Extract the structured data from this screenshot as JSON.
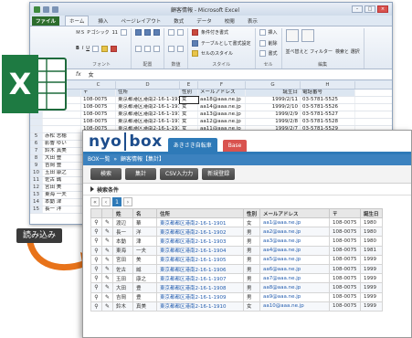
{
  "excel": {
    "title": "顧客情報 - Microsoft Excel",
    "tabs": [
      "ファイル",
      "ホーム",
      "挿入",
      "ページレイアウト",
      "数式",
      "データ",
      "校閲",
      "表示"
    ],
    "font_name": "ＭＳ Ｐゴシック",
    "font_size": "11",
    "ribbon": {
      "conditional_format": "条件付き書式",
      "table_format": "テーブルとして書式設定",
      "cell_style": "セルのスタイル",
      "style_label": "スタイル",
      "insert": "挿入",
      "delete": "削除",
      "format": "書式",
      "cell_label": "セル",
      "sort_filter": "並べ替えと フィルター",
      "find_select": "検索と 選択",
      "edit_label": "編集",
      "clipboard_label": "クリップ",
      "font_label": "フォント",
      "align_label": "配置",
      "number_label": "数値"
    },
    "formula_value": "女",
    "columns": [
      "C",
      "D",
      "E",
      "F",
      "G",
      "H"
    ],
    "header_row": {
      "num": "",
      "name": "",
      "zip": "〒",
      "addr": "住所",
      "sex": "性別",
      "mail": "メールアドレス",
      "birth": "誕生日",
      "tel": "電話番号"
    },
    "rows": [
      {
        "num": "",
        "name": "",
        "zip": "108-0075",
        "addr": "東京都港区港南2-16-1-1915",
        "sex": "女",
        "mail": "aa18@aaa.ne.jp",
        "birth": "1999/2/11",
        "tel": "03-5781-5525"
      },
      {
        "num": "",
        "name": "",
        "zip": "108-0075",
        "addr": "東京都港区港南2-16-1-1914",
        "sex": "女",
        "mail": "aa14@aaa.ne.jp",
        "birth": "1999/2/10",
        "tel": "03-5781-5526"
      },
      {
        "num": "",
        "name": "",
        "zip": "108-0075",
        "addr": "東京都港区港南2-16-1-1913",
        "sex": "女",
        "mail": "aa13@aaa.ne.jp",
        "birth": "1999/2/9",
        "tel": "03-5781-5527"
      },
      {
        "num": "",
        "name": "",
        "zip": "108-0075",
        "addr": "東京都港区港南2-16-1-1912",
        "sex": "女",
        "mail": "aa12@aaa.ne.jp",
        "birth": "1999/2/8",
        "tel": "03-5781-5528"
      },
      {
        "num": "",
        "name": "",
        "zip": "108-0075",
        "addr": "東京都港区港南2-16-1-1911",
        "sex": "女",
        "mail": "aa11@aaa.ne.jp",
        "birth": "1999/2/7",
        "tel": "03-5781-5529"
      },
      {
        "num": "5",
        "name": "赤松  志穂",
        "zip": "",
        "addr": "",
        "sex": "",
        "mail": "",
        "birth": "",
        "tel": ""
      },
      {
        "num": "6",
        "name": "影響  ゆい",
        "zip": "",
        "addr": "",
        "sex": "",
        "mail": "",
        "birth": "",
        "tel": ""
      },
      {
        "num": "7",
        "name": "鈴木  真美",
        "zip": "",
        "addr": "",
        "sex": "",
        "mail": "",
        "birth": "",
        "tel": ""
      },
      {
        "num": "8",
        "name": "大田  豊",
        "zip": "",
        "addr": "",
        "sex": "",
        "mail": "",
        "birth": "",
        "tel": ""
      },
      {
        "num": "9",
        "name": "吉岡  豊",
        "zip": "",
        "addr": "",
        "sex": "",
        "mail": "",
        "birth": "",
        "tel": ""
      },
      {
        "num": "10",
        "name": "玉田  康之",
        "zip": "",
        "addr": "",
        "sex": "",
        "mail": "",
        "birth": "",
        "tel": ""
      },
      {
        "num": "11",
        "name": "佐古  誠",
        "zip": "",
        "addr": "",
        "sex": "",
        "mail": "",
        "birth": "",
        "tel": ""
      },
      {
        "num": "12",
        "name": "宮田  美",
        "zip": "",
        "addr": "",
        "sex": "",
        "mail": "",
        "birth": "",
        "tel": ""
      },
      {
        "num": "13",
        "name": "東海  一夫",
        "zip": "",
        "addr": "",
        "sex": "",
        "mail": "",
        "birth": "",
        "tel": ""
      },
      {
        "num": "14",
        "name": "本動  津",
        "zip": "",
        "addr": "",
        "sex": "",
        "mail": "",
        "birth": "",
        "tel": ""
      },
      {
        "num": "15",
        "name": "長一  洋",
        "zip": "",
        "addr": "",
        "sex": "",
        "mail": "",
        "birth": "",
        "tel": ""
      }
    ]
  },
  "excel_logo_letter": "X",
  "import_label": "読み込み",
  "app": {
    "logo_left": "nyo",
    "logo_right": "box",
    "tab1": "あきさき自転車",
    "tab2": "Base",
    "breadcrumb": [
      "BOX一覧",
      "顧客情報【集計】"
    ],
    "buttons": [
      "検索",
      "集計",
      "CSV入力力",
      "新規登録"
    ],
    "search_label": "検索条件",
    "pager": [
      "«",
      "‹",
      "1",
      "›"
    ],
    "columns": [
      "",
      "",
      "姓",
      "名",
      "住所",
      "性別",
      "メールアドレス",
      "〒",
      "誕生日"
    ],
    "rows": [
      {
        "last": "渡辺",
        "first": "華",
        "addr": "東京都都区港南2-16-1-1901",
        "sex": "女",
        "mail": "aa1@aaa.ne.jp",
        "zip": "108-0075",
        "birth": "1980"
      },
      {
        "last": "長一",
        "first": "洋",
        "addr": "東京都都区港南2-16-1-1902",
        "sex": "男",
        "mail": "aa2@aaa.ne.jp",
        "zip": "108-0075",
        "birth": "1980"
      },
      {
        "last": "本動",
        "first": "津",
        "addr": "東京都都区港南2-16-1-1903",
        "sex": "男",
        "mail": "aa3@aaa.ne.jp",
        "zip": "108-0075",
        "birth": "1980"
      },
      {
        "last": "東海",
        "first": "一夫",
        "addr": "東京都都区港南2-16-1-1904",
        "sex": "男",
        "mail": "aa4@aaa.ne.jp",
        "zip": "108-0075",
        "birth": "1981"
      },
      {
        "last": "宮田",
        "first": "美",
        "addr": "東京都都区港南2-16-1-1905",
        "sex": "男",
        "mail": "aa5@aaa.ne.jp",
        "zip": "108-0075",
        "birth": "1999"
      },
      {
        "last": "佐古",
        "first": "誠",
        "addr": "東京都都区港南2-16-1-1906",
        "sex": "男",
        "mail": "aa6@aaa.ne.jp",
        "zip": "108-0075",
        "birth": "1999"
      },
      {
        "last": "玉田",
        "first": "康之",
        "addr": "東京都都区港南2-16-1-1907",
        "sex": "男",
        "mail": "aa7@aaa.ne.jp",
        "zip": "108-0075",
        "birth": "1999"
      },
      {
        "last": "大田",
        "first": "豊",
        "addr": "東京都都区港南2-16-1-1908",
        "sex": "男",
        "mail": "aa8@aaa.ne.jp",
        "zip": "108-0075",
        "birth": "1999"
      },
      {
        "last": "吉岡",
        "first": "豊",
        "addr": "東京都都区港南2-16-1-1909",
        "sex": "男",
        "mail": "aa9@aaa.ne.jp",
        "zip": "108-0075",
        "birth": "1999"
      },
      {
        "last": "鈴木",
        "first": "真美",
        "addr": "東京都都区港南2-16-1-1910",
        "sex": "女",
        "mail": "aa10@aaa.ne.jp",
        "zip": "108-0075",
        "birth": "1999"
      }
    ]
  },
  "colors": {
    "excel_green": "#217346",
    "app_blue": "#2e7ab8",
    "base_red": "#d9534f",
    "arrow_orange": "#e8731a"
  }
}
